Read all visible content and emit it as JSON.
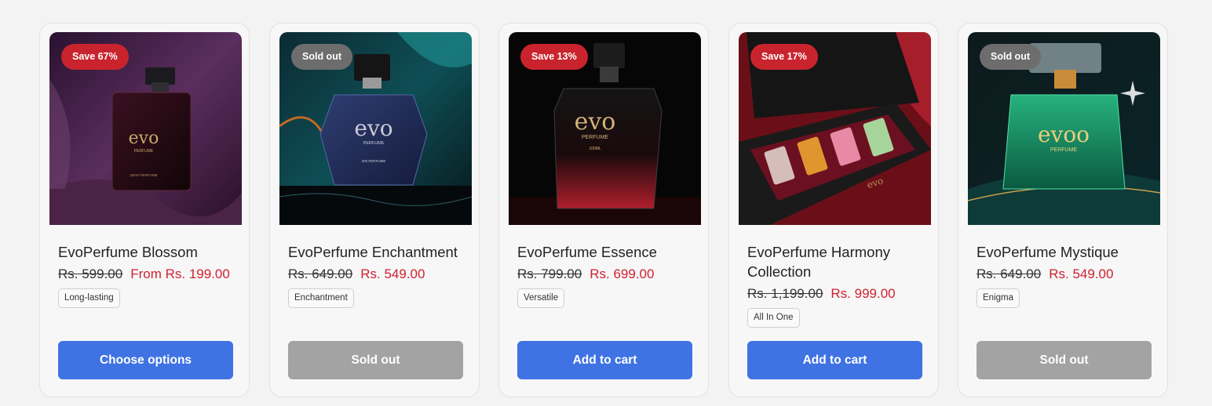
{
  "products": [
    {
      "badge": "Save 67%",
      "badge_type": "sale",
      "title": "EvoPerfume Blossom",
      "price_old": "Rs. 599.00",
      "price_new": "From Rs. 199.00",
      "tag": "Long-lasting",
      "button": "Choose options",
      "button_state": "primary",
      "image_text": {
        "brand": "evo",
        "sub": "PERFUME",
        "vol": "100ml PERFUME"
      }
    },
    {
      "badge": "Sold out",
      "badge_type": "sold",
      "title": "EvoPerfume Enchantment",
      "price_old": "Rs. 649.00",
      "price_new": "Rs. 549.00",
      "tag": "Enchantment",
      "button": "Sold out",
      "button_state": "disabled",
      "image_text": {
        "brand": "evo",
        "sub": "PERFUME",
        "vol": "200 PERFUME"
      }
    },
    {
      "badge": "Save 13%",
      "badge_type": "sale",
      "title": "EvoPerfume Essence",
      "price_old": "Rs. 799.00",
      "price_new": "Rs. 699.00",
      "tag": "Versatile",
      "button": "Add to cart",
      "button_state": "primary",
      "image_text": {
        "brand": "evo",
        "sub": "PERFUME",
        "vol": "100ML"
      }
    },
    {
      "badge": "Save 17%",
      "badge_type": "sale",
      "title": "EvoPerfume Harmony Collection",
      "price_old": "Rs. 1,199.00",
      "price_new": "Rs. 999.00",
      "tag": "All In One",
      "button": "Add to cart",
      "button_state": "primary",
      "image_text": {
        "brand": "evo",
        "sub": "",
        "vol": ""
      }
    },
    {
      "badge": "Sold out",
      "badge_type": "sold",
      "title": "EvoPerfume Mystique",
      "price_old": "Rs. 649.00",
      "price_new": "Rs. 549.00",
      "tag": "Enigma",
      "button": "Sold out",
      "button_state": "disabled",
      "image_text": {
        "brand": "evoo",
        "sub": "PERFUME",
        "vol": ""
      }
    }
  ],
  "colors": {
    "sale_badge": "#c9242e",
    "sold_badge": "#6d6d6d",
    "primary_button": "#3f73e3",
    "disabled_button": "#a3a3a3",
    "sale_price": "#d0202f"
  }
}
